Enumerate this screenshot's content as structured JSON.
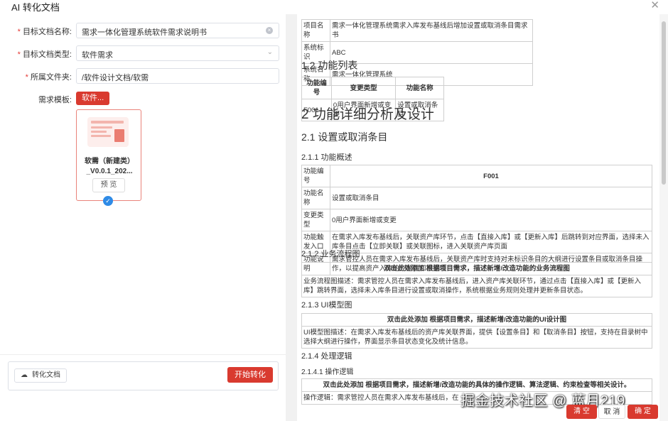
{
  "window": {
    "title": "AI 转化文档",
    "close_icon": "close-icon"
  },
  "form": {
    "target_name": {
      "label": "目标文档名称:",
      "value": "需求一体化管理系统软件需求说明书",
      "required": true
    },
    "target_type": {
      "label": "目标文档类型:",
      "value": "软件需求",
      "required": true
    },
    "folder": {
      "label": "所属文件夹:",
      "value": "/软件设计文档/软需",
      "required": true
    },
    "template": {
      "label": "需求模板:",
      "button": "软件..."
    }
  },
  "card": {
    "name": "软需（新建类）_V0.0.1_202...",
    "preview": "预 览",
    "selected": true
  },
  "actions": {
    "convert_doc": "转化文档",
    "start": "开始转化"
  },
  "doc": {
    "info_table": [
      [
        "项目名称",
        "需求一体化管理系统需求入库发布基线后增加设置或取消条目需求书"
      ],
      [
        "系统标识",
        "ABC"
      ],
      [
        "系统名称",
        "需求一体化管理系统"
      ]
    ],
    "h_func_list": "1.2 功能列表",
    "func_list": {
      "headers": [
        "功能编号",
        "变更类型",
        "功能名称"
      ],
      "rows": [
        [
          "F001",
          "0用户界面新增或变更",
          "设置或取消条目"
        ]
      ]
    },
    "h2": "2 功能详细分析及设计",
    "h21": "2.1 设置或取消条目",
    "h211": "2.1.1 功能概述",
    "overview": {
      "rows": [
        [
          "功能编号",
          "F001"
        ],
        [
          "功能名称",
          "设置或取消条目"
        ],
        [
          "变更类型",
          "0用户界面新增或变更"
        ],
        [
          "功能触发入口",
          "在需求入库发布基线后，关联资产库环节，点击【直接入库】或【更新入库】后跳转到对应界面，选择未入库条目点击【立即关联】或关联图标，进入关联资产库页面"
        ],
        [
          "功能说明",
          "需求管控人员在需求入库发布基线后，关联资产库时支持对未标识条目的大纲进行设置条目或取消条目操作，以提高资产入库的完整性和准确性"
        ]
      ]
    },
    "h212": "2.1.2 业务流程图",
    "flow": {
      "header": "双击此处添加 根据项目需求，描述新增/改造功能的业务流程图",
      "desc": "业务流程图描述：需求管控人员在需求入库发布基线后，进入资产库关联环节，通过点击【直接入库】或【更新入库】跳转界面，选择未入库条目进行设置或取消操作，系统根据业务规则处理并更新条目状态。"
    },
    "h213": "2.1.3 UI模型图",
    "ui": {
      "header": "双击此处添加 根据项目需求，描述新增/改造功能的UI设计图",
      "desc": "UI模型图描述：在需求入库发布基线后的资产库关联界面，提供【设置条目】和【取消条目】按钮，支持在目录树中选择大纲进行操作，界面显示条目状态变化及统计信息。"
    },
    "h214": "2.1.4 处理逻辑",
    "h2141": "2.1.4.1 操作逻辑",
    "logic": {
      "header": "双击此处添加 根据项目需求，描述新增/改造功能的具体的操作逻辑、算法逻辑、约束检查等相关设计。",
      "desc": "操作逻辑：需求管控人员在需求入库发布基线后，在"
    }
  },
  "footer": {
    "clear": "清 空",
    "cancel": "取 消",
    "confirm": "确 定"
  },
  "watermark": "掘金技术社区 @ 蓝月219",
  "colors": {
    "accent": "#d93a2f",
    "selected": "#2f8be6"
  }
}
